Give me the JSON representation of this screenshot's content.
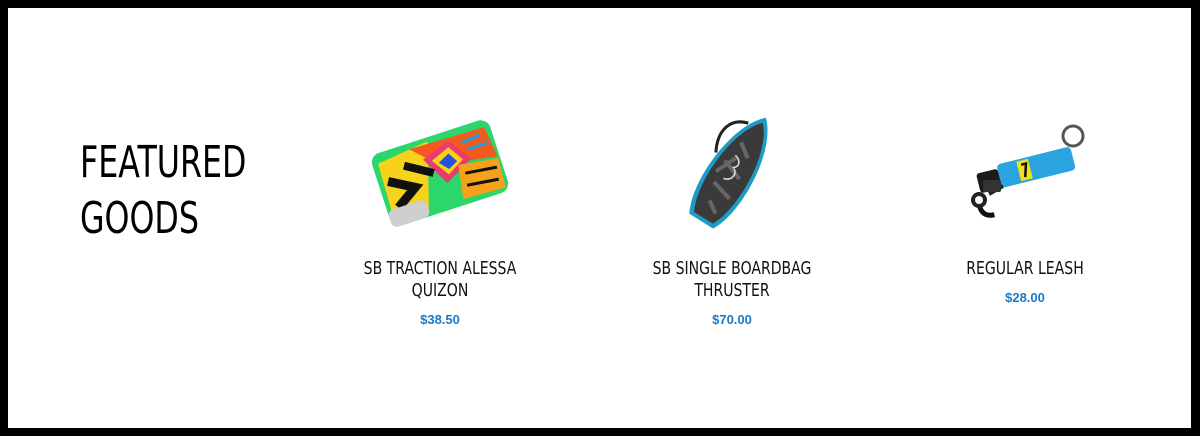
{
  "section": {
    "title_line1": "FEATURED",
    "title_line2": "GOODS"
  },
  "products": [
    {
      "name": "SB TRACTION ALESSA QUIZON",
      "price": "$38.50",
      "icon": "traction-pad-image"
    },
    {
      "name": "SB SINGLE BOARDBAG THRUSTER",
      "price": "$70.00",
      "icon": "boardbag-image"
    },
    {
      "name": "REGULAR LEASH",
      "price": "$28.00",
      "icon": "leash-image"
    }
  ],
  "colors": {
    "price": "#1a7ac8",
    "frame": "#000000"
  }
}
